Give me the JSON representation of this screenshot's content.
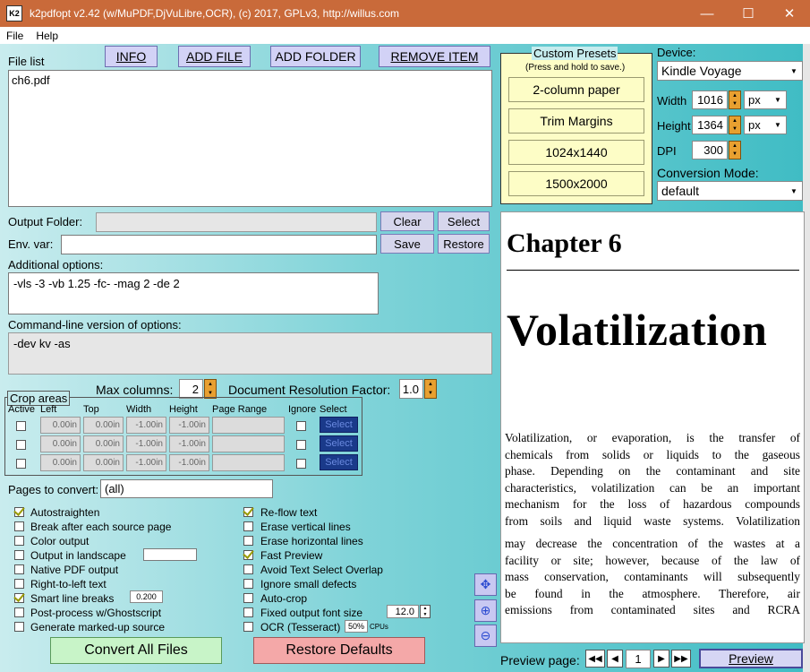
{
  "window": {
    "title": "k2pdfopt v2.42 (w/MuPDF,DjVuLibre,OCR), (c) 2017, GPLv3, http://willus.com",
    "icon": "K2",
    "minimize": "—",
    "maximize": "☐",
    "close": "✕"
  },
  "menu": {
    "file": "File",
    "help": "Help"
  },
  "filelist": {
    "label": "File list",
    "info": "INFO",
    "add_file": "ADD FILE",
    "add_folder": "ADD FOLDER",
    "remove_item": "REMOVE ITEM",
    "files": [
      "ch6.pdf"
    ]
  },
  "presets": {
    "title": "Custom Presets",
    "hint": "(Press and hold to save.)",
    "items": [
      "2-column paper",
      "Trim Margins",
      "1024x1440",
      "1500x2000"
    ]
  },
  "device": {
    "label": "Device:",
    "value": "Kindle Voyage",
    "width_label": "Width",
    "width": "1016",
    "width_unit": "px",
    "height_label": "Height",
    "height": "1364",
    "height_unit": "px",
    "dpi_label": "DPI",
    "dpi": "300",
    "mode_label": "Conversion Mode:",
    "mode": "default"
  },
  "output": {
    "folder_label": "Output Folder:",
    "folder_value": "",
    "clear": "Clear",
    "select": "Select",
    "env_label": "Env. var:",
    "env_value": "",
    "save": "Save",
    "restore": "Restore",
    "additional_label": "Additional options:",
    "additional_value": "-vls -3 -vb 1.25 -fc- -mag 2 -de 2",
    "cmdline_label": "Command-line version of options:",
    "cmdline_value": "-dev kv -as"
  },
  "columns": {
    "max_label": "Max columns:",
    "max_value": "2",
    "res_label": "Document Resolution Factor:",
    "res_value": "1.0"
  },
  "crop": {
    "title": "Crop areas",
    "headers": [
      "Active",
      "Left",
      "Top",
      "Width",
      "Height",
      "Page Range",
      "Ignore",
      "Select"
    ],
    "rows": [
      {
        "left": "0.00in",
        "top": "0.00in",
        "width": "-1.00in",
        "height": "-1.00in",
        "select": "Select"
      },
      {
        "left": "0.00in",
        "top": "0.00in",
        "width": "-1.00in",
        "height": "-1.00in",
        "select": "Select"
      },
      {
        "left": "0.00in",
        "top": "0.00in",
        "width": "-1.00in",
        "height": "-1.00in",
        "select": "Select"
      }
    ]
  },
  "pages": {
    "label": "Pages to convert:",
    "value": "(all)"
  },
  "options_left": [
    {
      "label": "Autostraighten",
      "checked": true
    },
    {
      "label": "Break after each source page",
      "checked": false
    },
    {
      "label": "Color output",
      "checked": false
    },
    {
      "label": "Output in landscape",
      "checked": false
    },
    {
      "label": "Native PDF output",
      "checked": false
    },
    {
      "label": "Right-to-left text",
      "checked": false
    },
    {
      "label": "Smart line breaks",
      "checked": true
    },
    {
      "label": "Post-process w/Ghostscript",
      "checked": false
    },
    {
      "label": "Generate marked-up source",
      "checked": false
    }
  ],
  "options_right": [
    {
      "label": "Re-flow text",
      "checked": true
    },
    {
      "label": "Erase vertical lines",
      "checked": false
    },
    {
      "label": "Erase horizontal lines",
      "checked": false
    },
    {
      "label": "Fast Preview",
      "checked": true
    },
    {
      "label": "Avoid Text Select Overlap",
      "checked": false
    },
    {
      "label": "Ignore small defects",
      "checked": false
    },
    {
      "label": "Auto-crop",
      "checked": false
    },
    {
      "label": "Fixed output font size",
      "checked": false
    },
    {
      "label": "OCR (Tesseract)",
      "checked": false
    }
  ],
  "option_values": {
    "smart_line_breaks": "0.200",
    "font_size": "12.0",
    "ocr_cpus": "50%",
    "cpus_label": "CPUs"
  },
  "actions": {
    "convert": "Convert All Files",
    "restore_defaults": "Restore Defaults"
  },
  "preview": {
    "chapter": "Chapter 6",
    "title": "Volatilization",
    "lines": [
      "Volatilization, or evaporation, is the transfer of",
      "chemicals from solids or liquids to the gaseous",
      "phase. Depending on the contaminant and site",
      "characteristics, volatilization can be an important",
      "mechanism for the loss of hazardous compounds",
      "from soils and liquid waste systems. Volatilization",
      "may decrease the concentration of the wastes at a",
      "facility or site; however, because of the law of",
      "mass conservation, contaminants will subsequently",
      "be found in the atmosphere. Therefore, air",
      "emissions from contaminated sites and RCRA"
    ],
    "page_label": "Preview page:",
    "page_value": "1",
    "preview_button": "Preview"
  }
}
